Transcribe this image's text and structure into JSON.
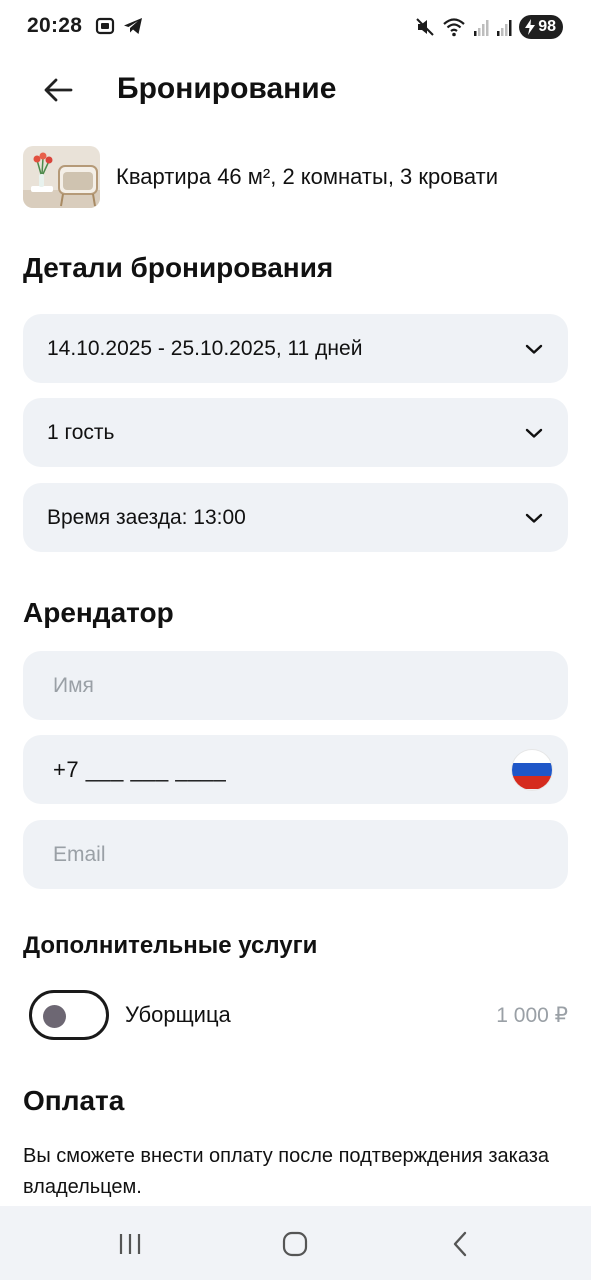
{
  "status_bar": {
    "time": "20:28",
    "battery": "98",
    "left_icons": [
      "screenshot-icon",
      "telegram-icon"
    ],
    "right_icons": [
      "mute-icon",
      "wifi-icon",
      "signal-icon",
      "signal-icon",
      "battery-charging-icon"
    ]
  },
  "header": {
    "title": "Бронирование",
    "back_icon": "arrow-left-icon"
  },
  "listing": {
    "title": "Квартира 46 м², 2 комнаты, 3 кровати"
  },
  "booking_details": {
    "heading": "Детали бронирования",
    "dates": "14.10.2025 - 25.10.2025, 11 дней",
    "guests": "1 гость",
    "checkin": "Время заезда: 13:00"
  },
  "tenant": {
    "heading": "Арендатор",
    "name_placeholder": "Имя",
    "phone_value": "+7 ___ ___ ____",
    "email_placeholder": "Email"
  },
  "services": {
    "heading": "Дополнительные услуги",
    "items": [
      {
        "label": "Уборщица",
        "price": "1 000 ₽",
        "enabled": false
      }
    ]
  },
  "payment": {
    "heading": "Оплата",
    "text": "Вы сможете внести оплату после подтверждения заказа владельцем."
  },
  "nav": {
    "icons": [
      "recent-apps-icon",
      "home-icon",
      "back-icon"
    ]
  },
  "colors": {
    "field_bg": "#eff2f6",
    "placeholder": "#9aa0a6",
    "nav_bg": "#f1f3f7",
    "flag": [
      "#ffffff",
      "#1f57c8",
      "#d52b1e"
    ]
  }
}
